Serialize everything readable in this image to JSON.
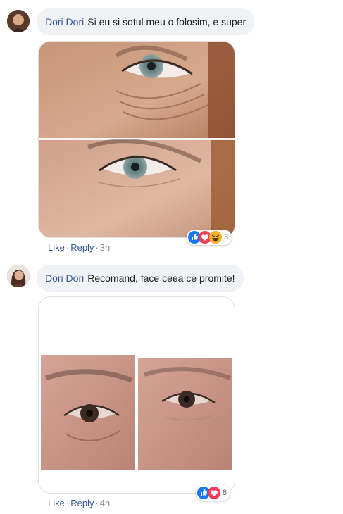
{
  "comments": [
    {
      "author": "Dori Dori",
      "text": "Si eu si sotul meu o folosim, e super",
      "actions": {
        "like": "Like",
        "reply": "Reply",
        "time": "3h"
      },
      "reactions": {
        "count": "3",
        "icons": [
          "like-icon",
          "love-icon",
          "haha-icon"
        ]
      }
    },
    {
      "author": "Dori Dori",
      "text": "Recomand, face ceea ce promite!",
      "actions": {
        "like": "Like",
        "reply": "Reply",
        "time": "4h"
      },
      "reactions": {
        "count": "8",
        "icons": [
          "like-icon",
          "love-icon"
        ]
      }
    }
  ],
  "colors": {
    "author": "#385898",
    "bubble": "#f0f2f5",
    "meta": "#8a8d91",
    "like": "#1877f2",
    "love": "#f33e58",
    "haha": "#f7b125"
  }
}
